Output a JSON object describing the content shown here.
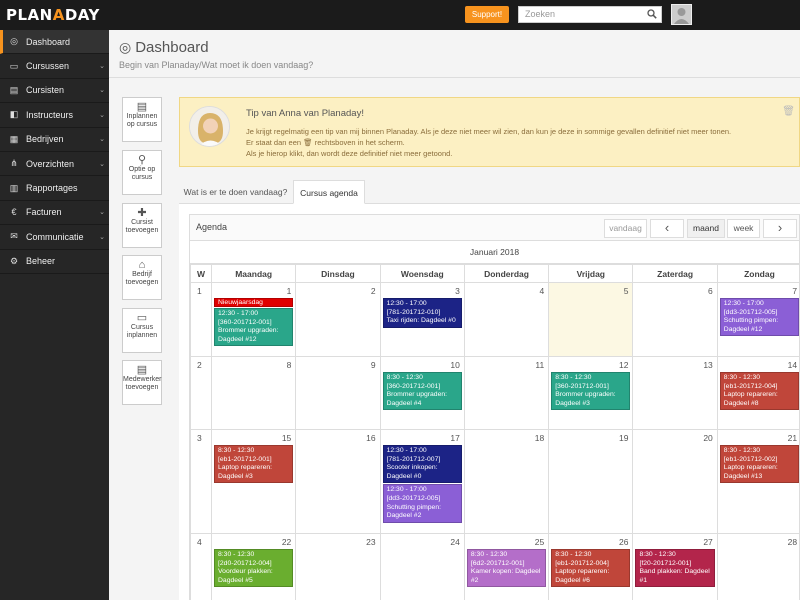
{
  "app": {
    "logo_a": "PLAN",
    "logo_b": "A",
    "logo_c": "DAY"
  },
  "topbar": {
    "support_label": "Support!",
    "search_placeholder": "Zoeken"
  },
  "sidebar": {
    "items": [
      {
        "label": "Dashboard",
        "icon": "dashboard-icon",
        "glyph": "◎",
        "chev": ""
      },
      {
        "label": "Cursussen",
        "icon": "book-icon",
        "glyph": "▭",
        "chev": "⌄"
      },
      {
        "label": "Cursisten",
        "icon": "id-card-icon",
        "glyph": "▤",
        "chev": "⌄"
      },
      {
        "label": "Instructeurs",
        "icon": "instructor-icon",
        "glyph": "◧",
        "chev": "⌄"
      },
      {
        "label": "Bedrijven",
        "icon": "building-icon",
        "glyph": "▦",
        "chev": "⌄"
      },
      {
        "label": "Overzichten",
        "icon": "sitemap-icon",
        "glyph": "⋔",
        "chev": "⌄"
      },
      {
        "label": "Rapportages",
        "icon": "bar-chart-icon",
        "glyph": "▥",
        "chev": ""
      },
      {
        "label": "Facturen",
        "icon": "euro-icon",
        "glyph": "€",
        "chev": "⌄"
      },
      {
        "label": "Communicatie",
        "icon": "envelope-icon",
        "glyph": "✉",
        "chev": "⌄"
      },
      {
        "label": "Beheer",
        "icon": "cogs-icon",
        "glyph": "⚙",
        "chev": ""
      }
    ]
  },
  "header": {
    "title": "Dashboard",
    "subtitle": "Begin van Planaday/Wat moet ik doen vandaag?"
  },
  "quick_actions": [
    {
      "line1": "Inplannen",
      "line2": "op cursus",
      "icon": "id-card-icon",
      "glyph": "▤"
    },
    {
      "line1": "Optie op",
      "line2": "cursus",
      "icon": "pin-icon",
      "glyph": "⚲"
    },
    {
      "line1": "Cursist",
      "line2": "toevoegen",
      "icon": "add-user-icon",
      "glyph": "✚"
    },
    {
      "line1": "Bedrijf",
      "line2": "toevoegen",
      "icon": "home-icon",
      "glyph": "⌂"
    },
    {
      "line1": "Cursus",
      "line2": "inplannen",
      "icon": "book-icon",
      "glyph": "▭"
    },
    {
      "line1": "Medewerker",
      "line2": "toevoegen",
      "icon": "id-card-icon",
      "glyph": "▤"
    }
  ],
  "tip": {
    "title": "Tip van Anna van Planaday!",
    "line1": "Je krijgt regelmatig een tip van mij binnen Planaday. Als je deze niet meer wil zien, dan kun je deze in sommige gevallen definitief niet meer tonen.",
    "line2": "Er staat dan een 🗑 rechtsboven in het scherm.",
    "line3": "Als je hierop klikt, dan wordt deze definitief niet meer getoond."
  },
  "tabs": [
    {
      "label": "Wat is er te doen vandaag?"
    },
    {
      "label": "Cursus agenda"
    }
  ],
  "agenda": {
    "title": "Agenda",
    "btn_today": "vandaag",
    "btn_prev": "‹",
    "btn_month": "maand",
    "btn_week": "week",
    "btn_next": "›",
    "month_title": "Januari 2018",
    "col_week": "W",
    "days": [
      "Maandag",
      "Dinsdag",
      "Woensdag",
      "Donderdag",
      "Vrijdag",
      "Zaterdag",
      "Zondag"
    ],
    "weeks": [
      {
        "w": "1",
        "days": [
          {
            "d": "1",
            "events": [
              {
                "holiday": true,
                "title": "Nieuwjaarsdag",
                "color": "#e00000"
              },
              {
                "time": "12:30 - 17:00",
                "code": "[360-201712-001]",
                "title": "Brommer upgraden: Dagdeel #12",
                "color": "#2aa68a"
              }
            ]
          },
          {
            "d": "2",
            "events": []
          },
          {
            "d": "3",
            "events": [
              {
                "time": "12:30 - 17:00",
                "code": "[781-201712-010]",
                "title": "Taxi rijden: Dagdeel #0",
                "color": "#1c2386"
              }
            ]
          },
          {
            "d": "4",
            "events": []
          },
          {
            "d": "5",
            "today": true,
            "events": []
          },
          {
            "d": "6",
            "events": []
          },
          {
            "d": "7",
            "events": [
              {
                "time": "12:30 - 17:00",
                "code": "[dd3-201712-005]",
                "title": "Schutting pimpen: Dagdeel #12",
                "color": "#8b5fd6"
              }
            ]
          }
        ]
      },
      {
        "w": "2",
        "days": [
          {
            "d": "8",
            "events": []
          },
          {
            "d": "9",
            "events": []
          },
          {
            "d": "10",
            "events": [
              {
                "time": "8:30 - 12:30",
                "code": "[360-201712-001]",
                "title": "Brommer upgraden: Dagdeel #4",
                "color": "#2aa68a"
              }
            ]
          },
          {
            "d": "11",
            "events": []
          },
          {
            "d": "12",
            "events": [
              {
                "time": "8:30 - 12:30",
                "code": "[360-201712-001]",
                "title": "Brommer upgraden: Dagdeel #3",
                "color": "#2aa68a"
              }
            ]
          },
          {
            "d": "13",
            "events": []
          },
          {
            "d": "14",
            "events": [
              {
                "time": "8:30 - 12:30",
                "code": "[eb1-201712-004]",
                "title": "Laptop repareren: Dagdeel #8",
                "color": "#c0463a"
              }
            ]
          }
        ]
      },
      {
        "w": "3",
        "days": [
          {
            "d": "15",
            "events": [
              {
                "time": "8:30 - 12:30",
                "code": "[eb1-201712-001]",
                "title": "Laptop repareren: Dagdeel #3",
                "color": "#c0463a"
              }
            ]
          },
          {
            "d": "16",
            "events": []
          },
          {
            "d": "17",
            "events": [
              {
                "time": "12:30 - 17:00",
                "code": "[781-201712-007]",
                "title": "Scooter inkopen: Dagdeel #0",
                "color": "#1c2386"
              },
              {
                "time": "12:30 - 17:00",
                "code": "[dd3-201712-005]",
                "title": "Schutting pimpen: Dagdeel #2",
                "color": "#8b5fd6"
              }
            ]
          },
          {
            "d": "18",
            "events": []
          },
          {
            "d": "19",
            "events": []
          },
          {
            "d": "20",
            "events": []
          },
          {
            "d": "21",
            "events": [
              {
                "time": "8:30 - 12:30",
                "code": "[eb1-201712-002]",
                "title": "Laptop repareren: Dagdeel #13",
                "color": "#c0463a"
              }
            ]
          }
        ]
      },
      {
        "w": "4",
        "days": [
          {
            "d": "22",
            "events": [
              {
                "time": "8:30 - 12:30",
                "code": "[2d0-201712-004]",
                "title": "Voordeur plakken: Dagdeel #5",
                "color": "#6aae2f"
              }
            ]
          },
          {
            "d": "23",
            "events": []
          },
          {
            "d": "24",
            "events": []
          },
          {
            "d": "25",
            "events": [
              {
                "time": "8:30 - 12:30",
                "code": "[6d2-201712-001]",
                "title": "Kamer kopen: Dagdeel #2",
                "color": "#b46ec9"
              }
            ]
          },
          {
            "d": "26",
            "events": [
              {
                "time": "8:30 - 12:30",
                "code": "[eb1-201712-004]",
                "title": "Laptop repareren: Dagdeel #6",
                "color": "#c0463a"
              }
            ]
          },
          {
            "d": "27",
            "events": [
              {
                "time": "8:30 - 12:30",
                "code": "[f20-201712-001]",
                "title": "Band plakken: Dagdeel #1",
                "color": "#b3254b"
              }
            ]
          },
          {
            "d": "28",
            "events": []
          }
        ]
      }
    ]
  }
}
